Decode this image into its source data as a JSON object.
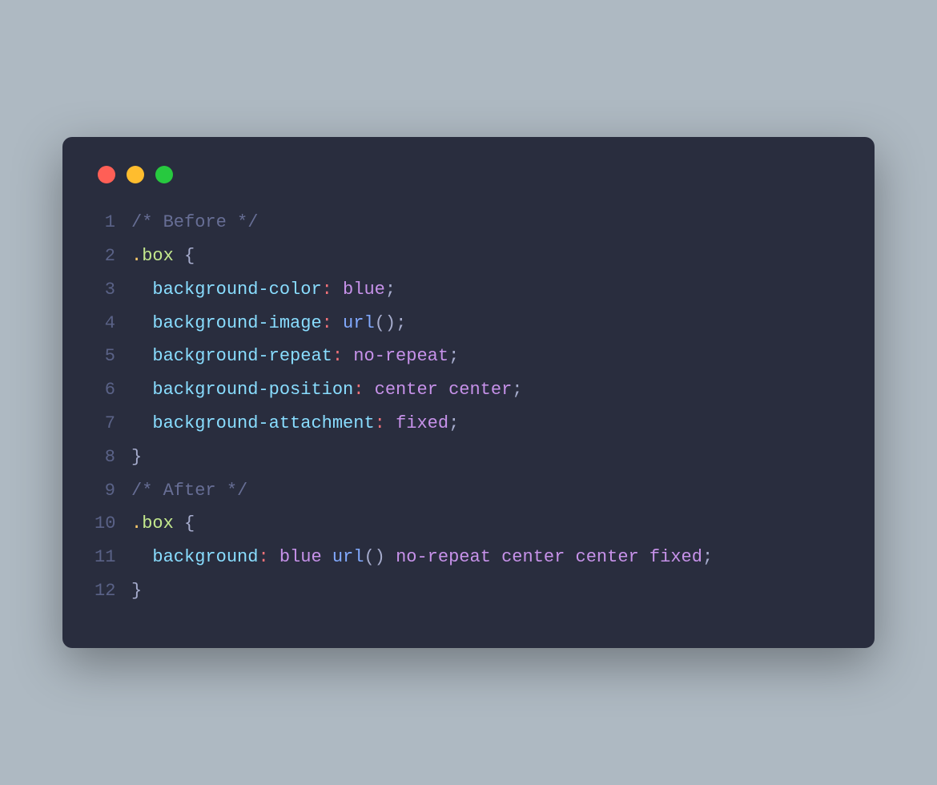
{
  "window": {
    "dots": [
      "red",
      "yellow",
      "green"
    ]
  },
  "code": {
    "lines": [
      {
        "num": "1",
        "tokens": [
          {
            "t": "/* Before */",
            "c": "tok-comment"
          }
        ]
      },
      {
        "num": "2",
        "tokens": [
          {
            "t": ".",
            "c": "tok-selector"
          },
          {
            "t": "box",
            "c": "tok-class"
          },
          {
            "t": " ",
            "c": ""
          },
          {
            "t": "{",
            "c": "tok-brace"
          }
        ]
      },
      {
        "num": "3",
        "tokens": [
          {
            "t": "  ",
            "c": ""
          },
          {
            "t": "background-color",
            "c": "tok-prop"
          },
          {
            "t": ":",
            "c": "tok-colon"
          },
          {
            "t": " ",
            "c": ""
          },
          {
            "t": "blue",
            "c": "tok-value"
          },
          {
            "t": ";",
            "c": "tok-semi"
          }
        ]
      },
      {
        "num": "4",
        "tokens": [
          {
            "t": "  ",
            "c": ""
          },
          {
            "t": "background-image",
            "c": "tok-prop"
          },
          {
            "t": ":",
            "c": "tok-colon"
          },
          {
            "t": " ",
            "c": ""
          },
          {
            "t": "url",
            "c": "tok-url"
          },
          {
            "t": "(",
            "c": "tok-paren"
          },
          {
            "t": ")",
            "c": "tok-paren"
          },
          {
            "t": ";",
            "c": "tok-semi"
          }
        ]
      },
      {
        "num": "5",
        "tokens": [
          {
            "t": "  ",
            "c": ""
          },
          {
            "t": "background-repeat",
            "c": "tok-prop"
          },
          {
            "t": ":",
            "c": "tok-colon"
          },
          {
            "t": " ",
            "c": ""
          },
          {
            "t": "no-repeat",
            "c": "tok-value"
          },
          {
            "t": ";",
            "c": "tok-semi"
          }
        ]
      },
      {
        "num": "6",
        "tokens": [
          {
            "t": "  ",
            "c": ""
          },
          {
            "t": "background-position",
            "c": "tok-prop"
          },
          {
            "t": ":",
            "c": "tok-colon"
          },
          {
            "t": " ",
            "c": ""
          },
          {
            "t": "center center",
            "c": "tok-value"
          },
          {
            "t": ";",
            "c": "tok-semi"
          }
        ]
      },
      {
        "num": "7",
        "tokens": [
          {
            "t": "  ",
            "c": ""
          },
          {
            "t": "background-attachment",
            "c": "tok-prop"
          },
          {
            "t": ":",
            "c": "tok-colon"
          },
          {
            "t": " ",
            "c": ""
          },
          {
            "t": "fixed",
            "c": "tok-value"
          },
          {
            "t": ";",
            "c": "tok-semi"
          }
        ]
      },
      {
        "num": "8",
        "tokens": [
          {
            "t": "}",
            "c": "tok-brace"
          }
        ]
      },
      {
        "num": "9",
        "tokens": [
          {
            "t": "/* After */",
            "c": "tok-comment"
          }
        ]
      },
      {
        "num": "10",
        "tokens": [
          {
            "t": ".",
            "c": "tok-selector"
          },
          {
            "t": "box",
            "c": "tok-class"
          },
          {
            "t": " ",
            "c": ""
          },
          {
            "t": "{",
            "c": "tok-brace"
          }
        ]
      },
      {
        "num": "11",
        "tokens": [
          {
            "t": "  ",
            "c": ""
          },
          {
            "t": "background",
            "c": "tok-prop"
          },
          {
            "t": ":",
            "c": "tok-colon"
          },
          {
            "t": " ",
            "c": ""
          },
          {
            "t": "blue",
            "c": "tok-value"
          },
          {
            "t": " ",
            "c": ""
          },
          {
            "t": "url",
            "c": "tok-url"
          },
          {
            "t": "(",
            "c": "tok-paren"
          },
          {
            "t": ")",
            "c": "tok-paren"
          },
          {
            "t": " ",
            "c": ""
          },
          {
            "t": "no-repeat center center fixed",
            "c": "tok-value"
          },
          {
            "t": ";",
            "c": "tok-semi"
          }
        ]
      },
      {
        "num": "12",
        "tokens": [
          {
            "t": "}",
            "c": "tok-brace"
          }
        ]
      }
    ]
  }
}
